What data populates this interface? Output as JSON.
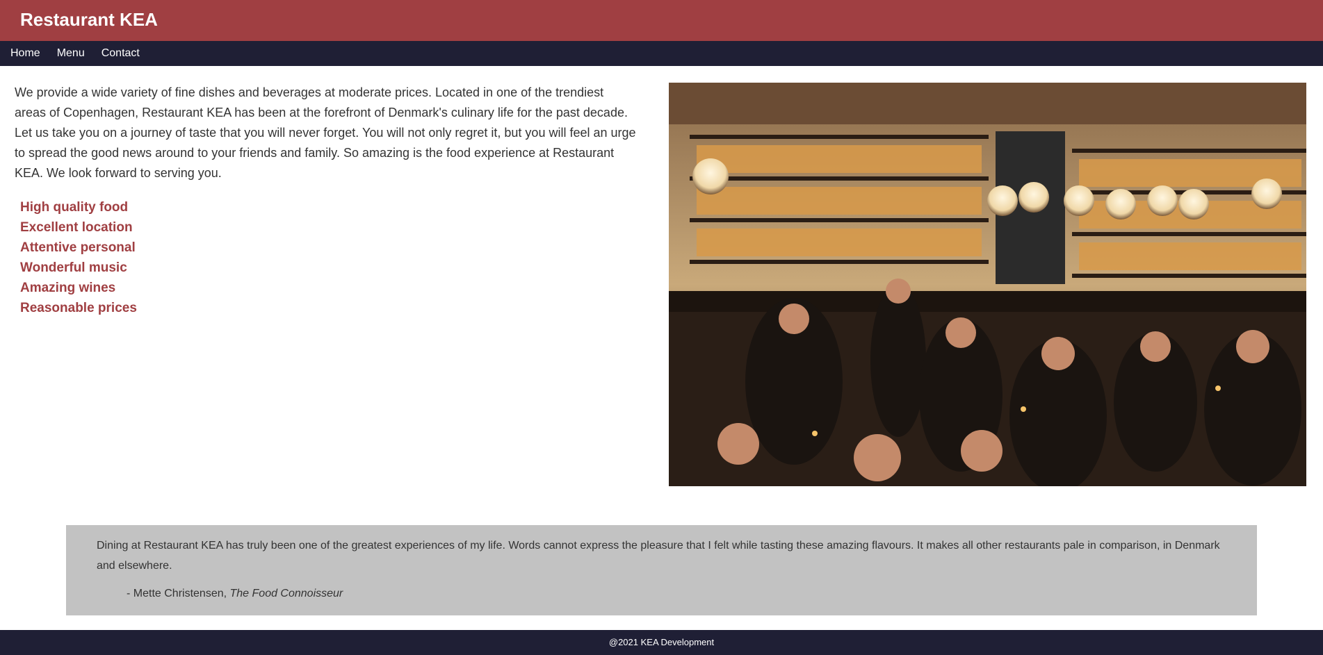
{
  "header": {
    "title": "Restaurant KEA"
  },
  "nav": {
    "items": [
      {
        "label": "Home"
      },
      {
        "label": "Menu"
      },
      {
        "label": "Contact"
      }
    ]
  },
  "intro": {
    "text": "We provide a wide variety of fine dishes and beverages at moderate prices. Located in one of the trendiest areas of Copenhagen, Restaurant KEA has been at the forefront of Denmark's culinary life for the past decade. Let us take you on a journey of taste that you will never forget. You will not only regret it, but you will feel an urge to spread the good news around to your friends and family. So amazing is the food experience at Restaurant KEA. We look forward to serving you."
  },
  "features": [
    "High quality food",
    "Excellent location",
    "Attentive personal",
    "Wonderful music",
    "Amazing wines",
    "Reasonable prices"
  ],
  "review": {
    "text": "Dining at Restaurant KEA has truly been one of the greatest experiences of my life. Words cannot express the pleasure that I felt while tasting these amazing flavours. It makes all other restaurants pale in comparison, in Denmark and elsewhere.",
    "author_prefix": "- Mette Christensen, ",
    "author_source": "The Food Connoisseur"
  },
  "footer": {
    "text": "@2021 KEA Development"
  },
  "colors": {
    "brand": "#a03f42",
    "nav": "#1f1f35",
    "review_bg": "#c2c2c2",
    "text": "#333333"
  }
}
